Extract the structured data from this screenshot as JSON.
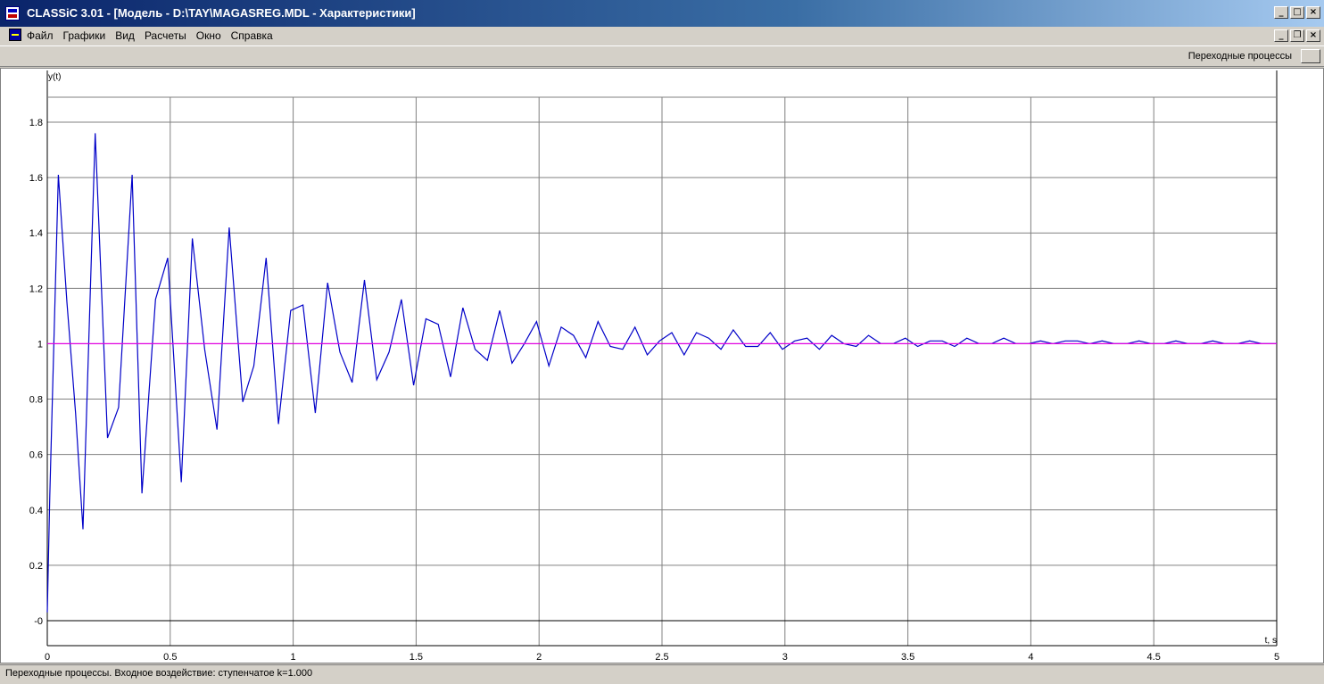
{
  "window": {
    "title": "CLASSiC 3.01 - [Модель - D:\\TAY\\MAGASREG.MDL - Характеристики]",
    "minimize_glyph": "_",
    "maximize_glyph": "□",
    "close_glyph": "×",
    "restore_glyph": "❐"
  },
  "menu": {
    "items": [
      "Файл",
      "Графики",
      "Вид",
      "Расчеты",
      "Окно",
      "Справка"
    ]
  },
  "toolbar": {
    "label": "Переходные процессы"
  },
  "status": {
    "text": "Переходные процессы. Входное воздействие:  ступенчатое k=1.000"
  },
  "colors": {
    "response": "#0000c8",
    "reference": "#e000e0",
    "grid": "#808080"
  },
  "chart_data": {
    "type": "line",
    "xlabel": "t, s",
    "ylabel": "y(t)",
    "xlim": [
      0,
      5
    ],
    "ylim": [
      -0.09,
      1.89
    ],
    "x_ticks": [
      0,
      0.5,
      1,
      1.5,
      2,
      2.5,
      3,
      3.5,
      4,
      4.5,
      5
    ],
    "x_tick_labels": [
      "0",
      "0.5",
      "1",
      "1.5",
      "2",
      "2.5",
      "3",
      "3.5",
      "4",
      "4.5",
      "5"
    ],
    "y_ticks": [
      0,
      0.2,
      0.4,
      0.6,
      0.8,
      1,
      1.2,
      1.4,
      1.6,
      1.8
    ],
    "y_tick_labels": [
      "-0",
      "0.2",
      "0.4",
      "0.6",
      "0.8",
      "1",
      "1.2",
      "1.4",
      "1.6",
      "1.8"
    ],
    "grid": true,
    "series": [
      {
        "x": [
          0,
          0.01,
          0.045,
          0.08,
          0.115,
          0.145,
          0.195,
          0.245,
          0.29,
          0.345,
          0.385,
          0.44,
          0.49,
          0.545,
          0.59,
          0.64,
          0.69,
          0.74,
          0.795,
          0.84,
          0.89,
          0.94,
          0.99,
          1.04,
          1.09,
          1.14,
          1.19,
          1.24,
          1.29,
          1.34,
          1.39,
          1.44,
          1.49,
          1.54,
          1.59,
          1.64,
          1.69,
          1.74,
          1.79,
          1.84,
          1.89,
          1.94,
          1.99,
          2.04,
          2.09,
          2.14,
          2.19,
          2.24,
          2.29,
          2.34,
          2.39,
          2.44,
          2.49,
          2.54,
          2.59,
          2.64,
          2.69,
          2.74,
          2.79,
          2.84,
          2.89,
          2.94,
          2.99,
          3.04,
          3.09,
          3.14,
          3.19,
          3.24,
          3.29,
          3.34,
          3.39,
          3.44,
          3.49,
          3.54,
          3.59,
          3.64,
          3.69,
          3.74,
          3.79,
          3.84,
          3.89,
          3.94,
          3.99,
          4.04,
          4.09,
          4.14,
          4.19,
          4.24,
          4.29,
          4.34,
          4.39,
          4.44,
          4.49,
          4.54,
          4.59,
          4.64,
          4.69,
          4.74,
          4.79,
          4.84,
          4.89,
          4.94,
          5.0
        ],
        "y": [
          0.03,
          0.45,
          1.61,
          1.15,
          0.75,
          0.33,
          1.76,
          0.66,
          0.77,
          1.61,
          0.46,
          1.16,
          1.31,
          0.5,
          1.38,
          0.98,
          0.69,
          1.42,
          0.79,
          0.92,
          1.31,
          0.71,
          1.12,
          1.14,
          0.75,
          1.22,
          0.97,
          0.86,
          1.23,
          0.87,
          0.97,
          1.16,
          0.85,
          1.09,
          1.07,
          0.88,
          1.13,
          0.98,
          0.94,
          1.12,
          0.93,
          1.0,
          1.08,
          0.92,
          1.06,
          1.03,
          0.95,
          1.08,
          0.99,
          0.98,
          1.06,
          0.96,
          1.01,
          1.04,
          0.96,
          1.04,
          1.02,
          0.98,
          1.05,
          0.99,
          0.99,
          1.04,
          0.98,
          1.01,
          1.02,
          0.98,
          1.03,
          1.0,
          0.99,
          1.03,
          1.0,
          1.0,
          1.02,
          0.99,
          1.01,
          1.01,
          0.99,
          1.02,
          1.0,
          1.0,
          1.02,
          1.0,
          1.0,
          1.01,
          1.0,
          1.01,
          1.01,
          1.0,
          1.01,
          1.0,
          1.0,
          1.01,
          1.0,
          1.0,
          1.01,
          1.0,
          1.0,
          1.01,
          1.0,
          1.0,
          1.01,
          1.0,
          1.0
        ]
      },
      {
        "x": [
          0,
          5
        ],
        "y": [
          1,
          1
        ]
      }
    ]
  }
}
